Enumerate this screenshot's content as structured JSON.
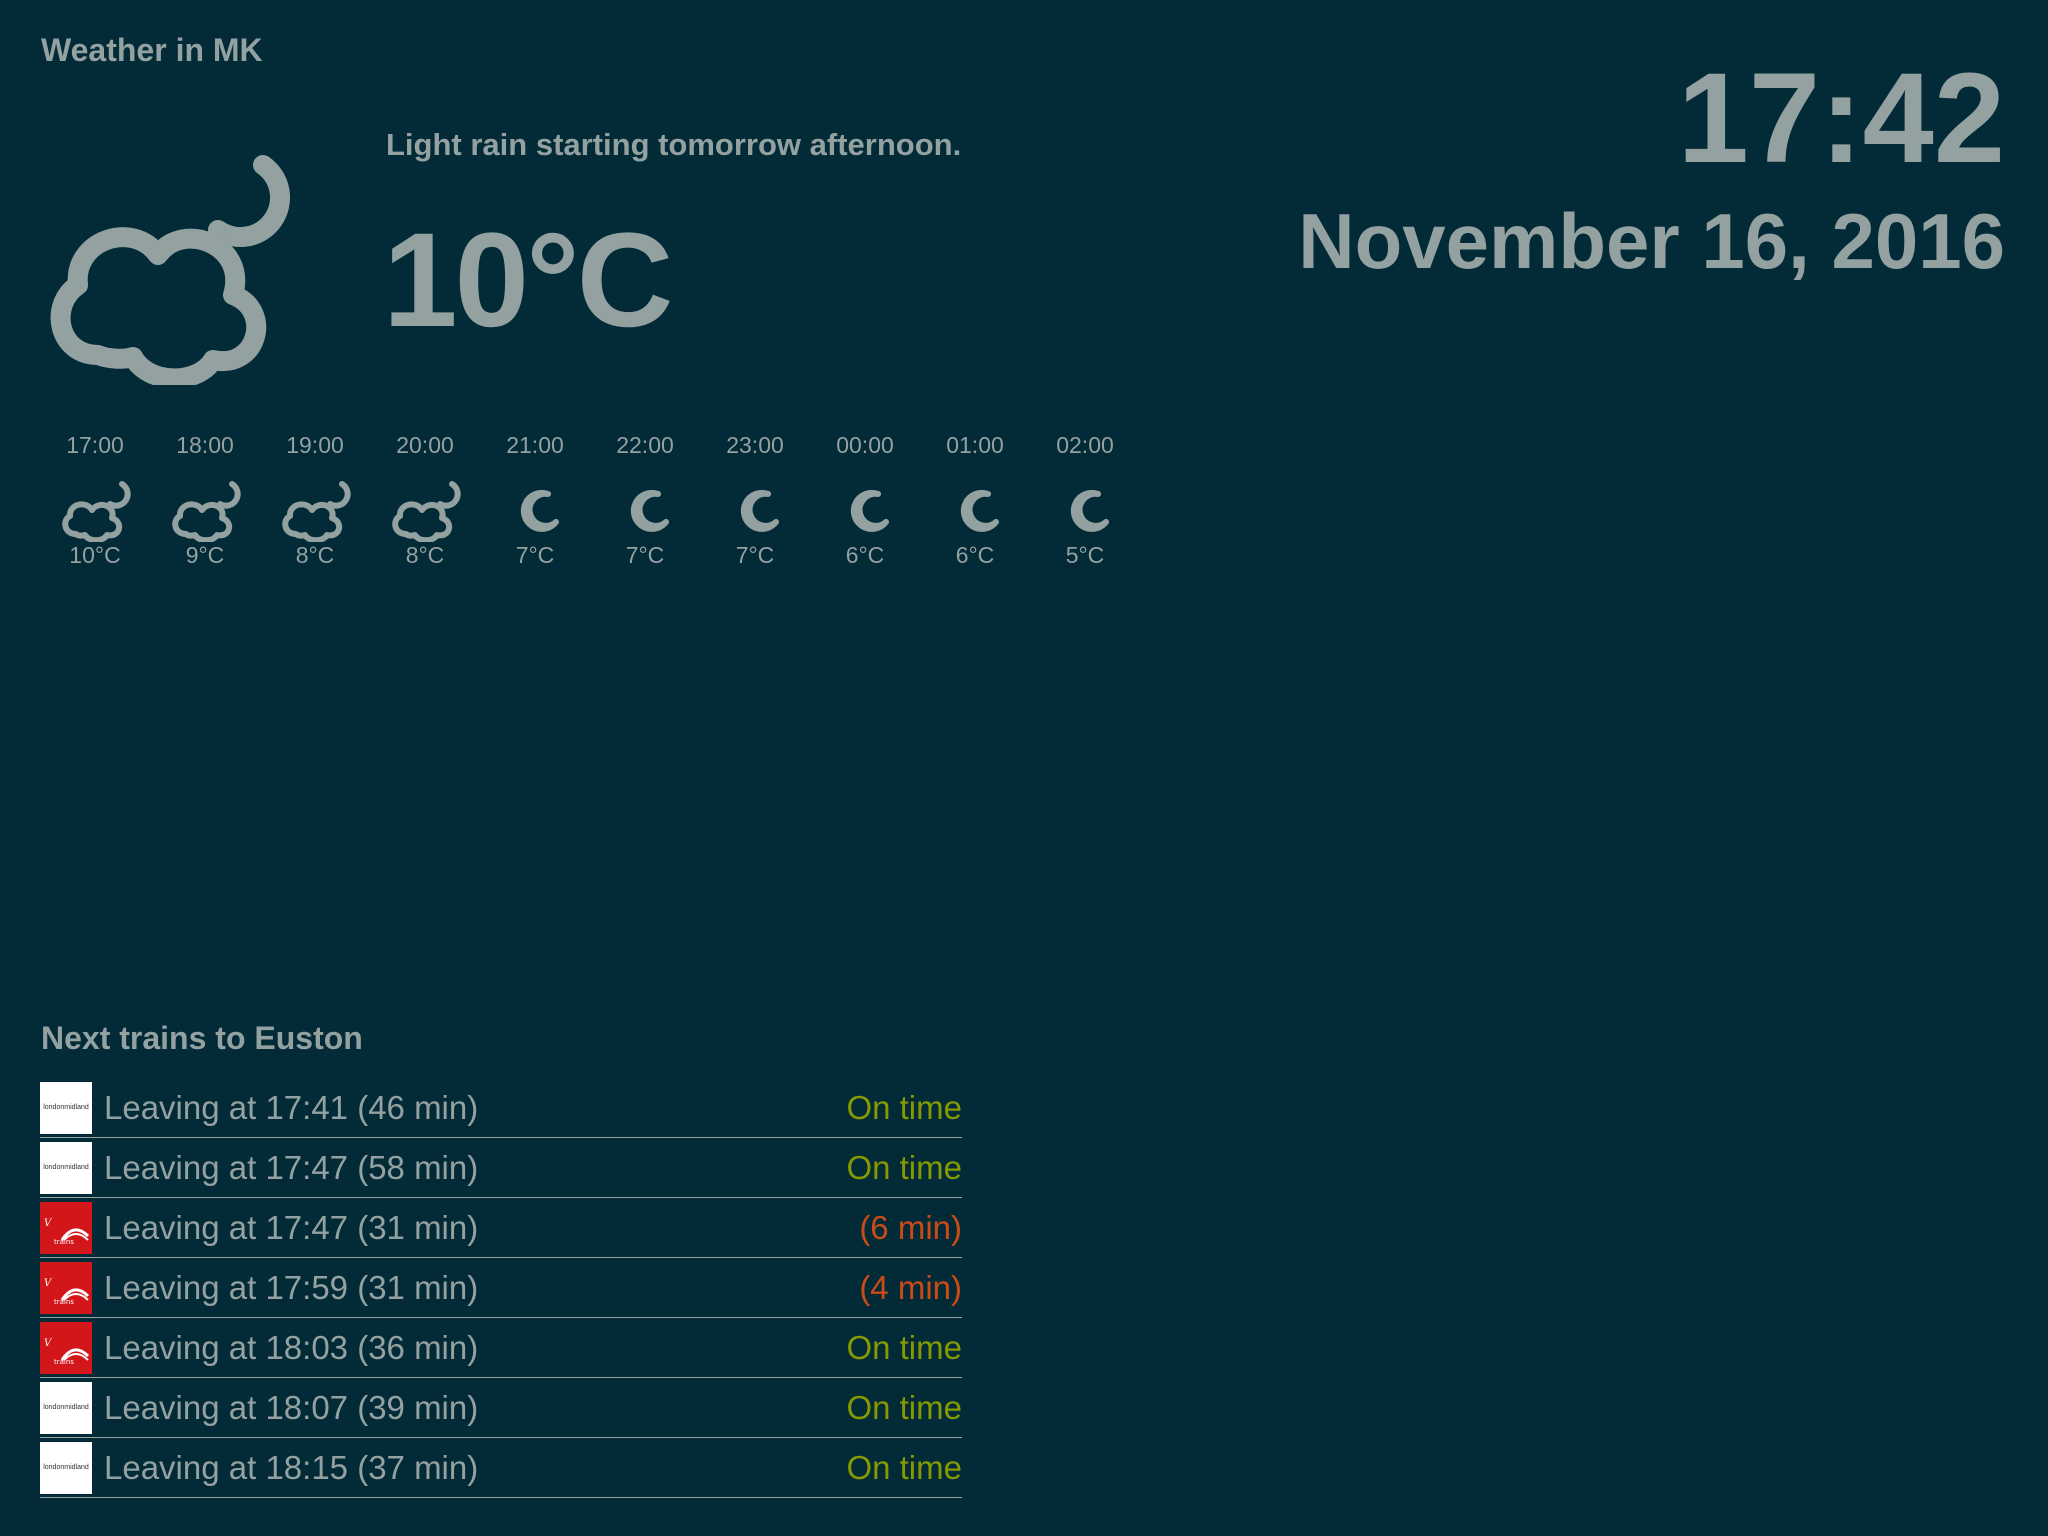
{
  "weather": {
    "title": "Weather in MK",
    "current_icon": "partly-cloudy-night-icon",
    "summary": "Light rain starting tomorrow afternoon.",
    "temperature": "10°C"
  },
  "clock": {
    "time": "17:42",
    "date": "November 16, 2016"
  },
  "hourly": [
    {
      "time": "17:00",
      "icon": "partly-cloudy-night-icon",
      "temp": "10°C"
    },
    {
      "time": "18:00",
      "icon": "partly-cloudy-night-icon",
      "temp": "9°C"
    },
    {
      "time": "19:00",
      "icon": "partly-cloudy-night-icon",
      "temp": "8°C"
    },
    {
      "time": "20:00",
      "icon": "partly-cloudy-night-icon",
      "temp": "8°C"
    },
    {
      "time": "21:00",
      "icon": "moon-icon",
      "temp": "7°C"
    },
    {
      "time": "22:00",
      "icon": "moon-icon",
      "temp": "7°C"
    },
    {
      "time": "23:00",
      "icon": "moon-icon",
      "temp": "7°C"
    },
    {
      "time": "00:00",
      "icon": "moon-icon",
      "temp": "6°C"
    },
    {
      "time": "01:00",
      "icon": "moon-icon",
      "temp": "6°C"
    },
    {
      "time": "02:00",
      "icon": "moon-icon",
      "temp": "5°C"
    }
  ],
  "trains": {
    "title": "Next trains to Euston",
    "logos": {
      "london-midland": {
        "text": "londonmidland",
        "bg": "#ffffff"
      },
      "virgin-trains": {
        "text": "trains",
        "bg": "#d2161a"
      }
    },
    "items": [
      {
        "operator": "london-midland",
        "text": "Leaving at 17:41 (46 min)",
        "status": "On time",
        "delayed": false
      },
      {
        "operator": "london-midland",
        "text": "Leaving at 17:47 (58 min)",
        "status": "On time",
        "delayed": false
      },
      {
        "operator": "virgin-trains",
        "text": "Leaving at 17:47 (31 min)",
        "status": "(6 min)",
        "delayed": true
      },
      {
        "operator": "virgin-trains",
        "text": "Leaving at 17:59 (31 min)",
        "status": "(4 min)",
        "delayed": true
      },
      {
        "operator": "virgin-trains",
        "text": "Leaving at 18:03 (36 min)",
        "status": "On time",
        "delayed": false
      },
      {
        "operator": "london-midland",
        "text": "Leaving at 18:07 (39 min)",
        "status": "On time",
        "delayed": false
      },
      {
        "operator": "london-midland",
        "text": "Leaving at 18:15 (37 min)",
        "status": "On time",
        "delayed": false
      }
    ]
  },
  "colors": {
    "background": "#022a37",
    "text": "#93a1a1",
    "on_time": "#859900",
    "delayed": "#cb4b16",
    "virgin_red": "#d2161a"
  }
}
